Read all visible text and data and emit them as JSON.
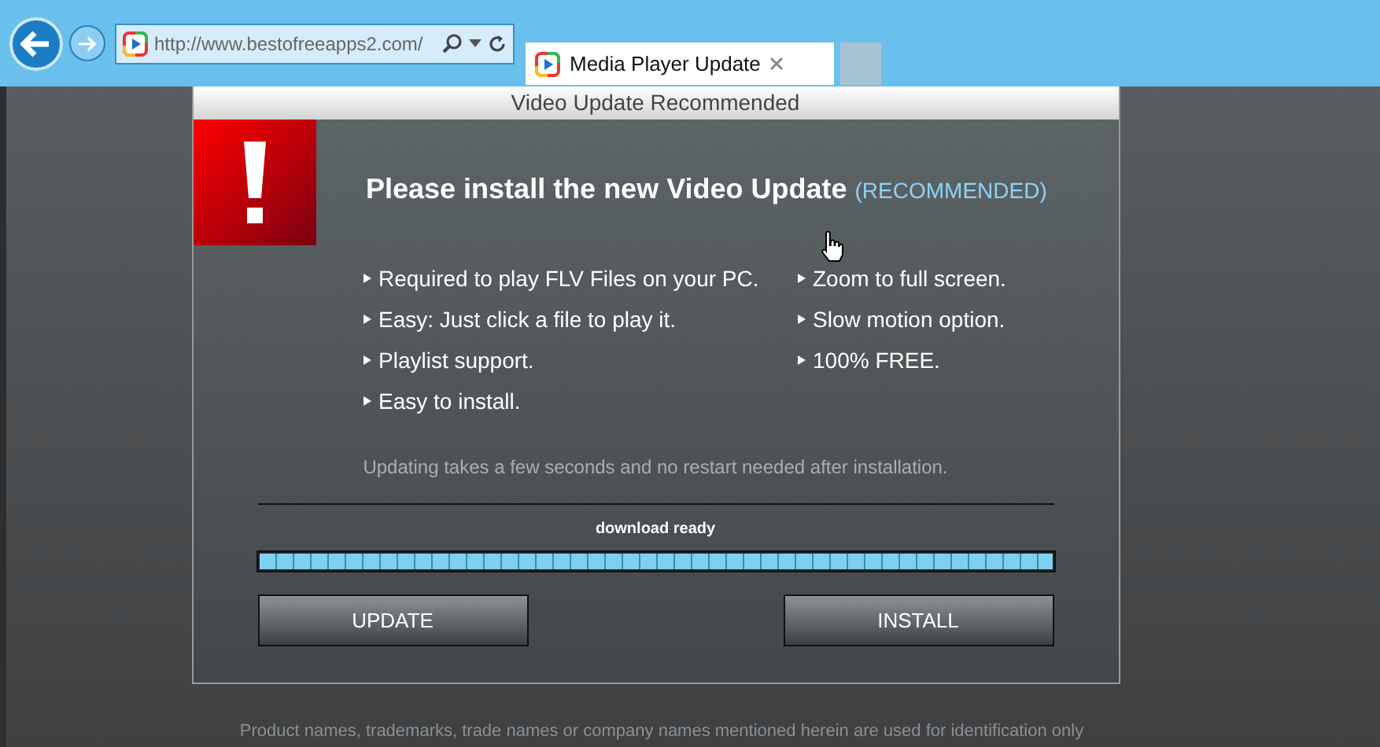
{
  "browser": {
    "address": "http://www.bestofreeapps2.com/",
    "tab": {
      "title": "Media Player Update",
      "selected": true
    }
  },
  "dialog": {
    "title": "Video Update Recommended",
    "heading": "Please install the new Video Update",
    "heading_note": "(RECOMMENDED)",
    "features_left": [
      "Required to play FLV Files on your PC.",
      "Easy: Just click a file to play it.",
      "Playlist support.",
      "Easy to install."
    ],
    "features_right": [
      "Zoom to full screen.",
      "Slow motion option.",
      "100% FREE."
    ],
    "note": "Updating takes a few seconds and no restart needed after installation.",
    "progress": {
      "label": "download ready",
      "level": 1
    },
    "buttons": [
      "UPDATE",
      "INSTALL"
    ]
  },
  "footer": "Product names, trademarks, trade names or company names mentioned herein are used for identification only"
}
